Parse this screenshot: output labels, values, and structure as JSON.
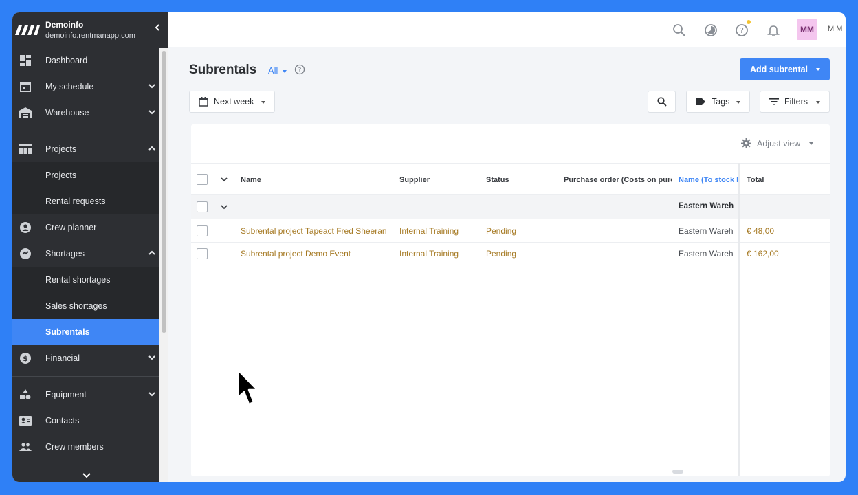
{
  "sidebar": {
    "account_name": "Demoinfo",
    "account_url": "demoinfo.rentmanapp.com",
    "items": [
      {
        "label": "Dashboard",
        "icon": "dashboard-icon"
      },
      {
        "label": "My schedule",
        "icon": "calendar-icon"
      },
      {
        "label": "Warehouse",
        "icon": "warehouse-icon"
      },
      {
        "label": "Projects",
        "icon": "projects-icon"
      },
      {
        "label": "Projects"
      },
      {
        "label": "Rental requests"
      },
      {
        "label": "Crew planner",
        "icon": "crew-planner-icon"
      },
      {
        "label": "Shortages",
        "icon": "shortages-icon"
      },
      {
        "label": "Rental shortages"
      },
      {
        "label": "Sales shortages"
      },
      {
        "label": "Subrentals"
      },
      {
        "label": "Financial",
        "icon": "dollar-icon"
      },
      {
        "label": "Equipment",
        "icon": "equipment-icon"
      },
      {
        "label": "Contacts",
        "icon": "contacts-icon"
      },
      {
        "label": "Crew members",
        "icon": "crew-members-icon"
      }
    ]
  },
  "topbar": {
    "avatar_initials": "MM",
    "user_label": "M M"
  },
  "page": {
    "title": "Subrentals",
    "view_filter": "All",
    "add_button": "Add subrental",
    "date_filter": "Next week",
    "tags_button": "Tags",
    "filters_button": "Filters",
    "adjust_view": "Adjust view"
  },
  "table": {
    "columns": [
      "Name",
      "Supplier",
      "Status",
      "Purchase order (Costs on purcha",
      "Name (To stock loc",
      "Total"
    ],
    "group_label": "Eastern Wareh",
    "rows": [
      {
        "name": "Subrental project Tapeact Fred Sheeran",
        "supplier": "Internal Training",
        "status": "Pending",
        "location": "Eastern Wareh",
        "total": "€ 48,00"
      },
      {
        "name": "Subrental project Demo Event",
        "supplier": "Internal Training",
        "status": "Pending",
        "location": "Eastern Wareh",
        "total": "€ 162,00"
      }
    ]
  },
  "colors": {
    "accent": "#3f86f5",
    "sidebar_bg": "#2d2f33",
    "link_gold": "#a67a24",
    "avatar_bg": "#f4c6ee"
  }
}
